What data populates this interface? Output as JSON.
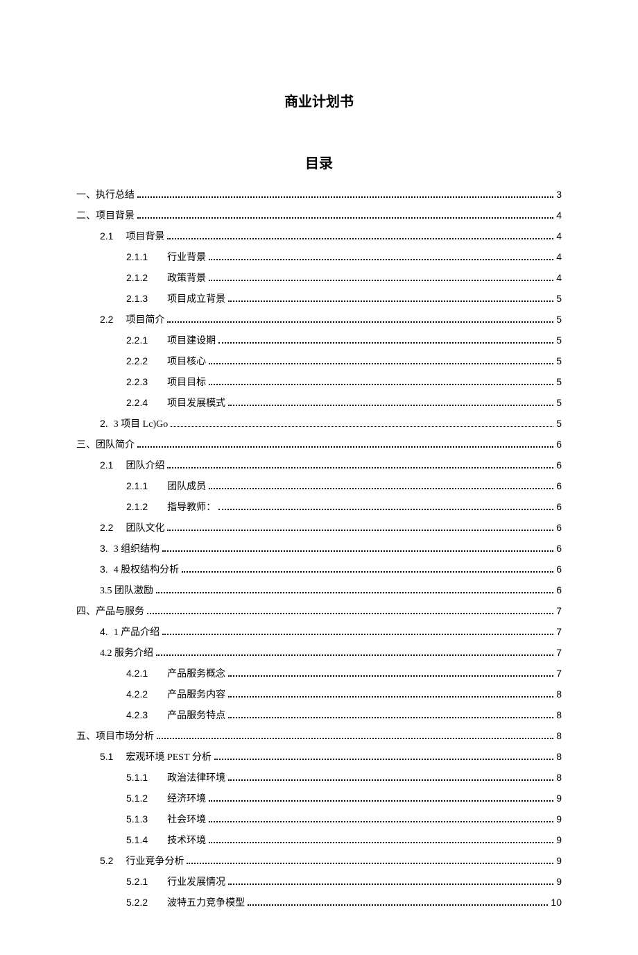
{
  "doc_title": "商业计划书",
  "toc_title": "目录",
  "toc": [
    {
      "indent": 0,
      "num": "",
      "text": "一、执行总结",
      "page": "3",
      "dot": "thick"
    },
    {
      "indent": 0,
      "num": "",
      "text": "二、项目背景",
      "page": "4",
      "dot": "thick"
    },
    {
      "indent": 1,
      "num": "2.1",
      "numClass": "num-l2",
      "text": "项目背景",
      "page": "4",
      "dot": "thick"
    },
    {
      "indent": 2,
      "num": "2.1.1",
      "numClass": "num-l3",
      "text": "行业背景",
      "page": "4",
      "dot": "thick"
    },
    {
      "indent": 2,
      "num": "2.1.2",
      "numClass": "num-l3",
      "text": "政策背景",
      "page": "4",
      "dot": "thick"
    },
    {
      "indent": 2,
      "num": "2.1.3",
      "numClass": "num-l3",
      "text": "项目成立背景",
      "page": "5",
      "dot": "thick"
    },
    {
      "indent": 1,
      "num": "2.2",
      "numClass": "num-l2",
      "text": "项目简介",
      "page": "5",
      "dot": "thick"
    },
    {
      "indent": 2,
      "num": "2.2.1",
      "numClass": "num-l3",
      "text": "项目建设期",
      "page": "5",
      "dot": "thick"
    },
    {
      "indent": 2,
      "num": "2.2.2",
      "numClass": "num-l3",
      "text": "项目核心",
      "page": "5",
      "dot": "thick"
    },
    {
      "indent": 2,
      "num": "2.2.3",
      "numClass": "num-l3",
      "text": "项目目标",
      "page": "5",
      "dot": "thick"
    },
    {
      "indent": 2,
      "num": "2.2.4",
      "numClass": "num-l3",
      "text": "项目发展模式",
      "page": "5",
      "dot": "thick"
    },
    {
      "indent": 1,
      "num": "2.",
      "numClass": "num-l2s",
      "text": "3 项目 Lc)Go",
      "page": "5",
      "dot": "thin"
    },
    {
      "indent": 0,
      "num": "",
      "text": "三、团队简介",
      "page": "6",
      "dot": "thick"
    },
    {
      "indent": 1,
      "num": "2.1",
      "numClass": "num-l2",
      "text": "团队介绍",
      "page": "6",
      "dot": "thick"
    },
    {
      "indent": 2,
      "num": "2.1.1",
      "numClass": "num-l3",
      "text": "团队成员",
      "page": "6",
      "dot": "thick"
    },
    {
      "indent": 2,
      "num": "2.1.2",
      "numClass": "num-l3",
      "text": "指导教师：",
      "page": "6",
      "dot": "thick"
    },
    {
      "indent": 1,
      "num": "2.2",
      "numClass": "num-l2",
      "text": "团队文化",
      "page": "6",
      "dot": "thick"
    },
    {
      "indent": 1,
      "num": "3.",
      "numClass": "num-l2s",
      "text": "3 组织结构",
      "page": "6",
      "dot": "thick"
    },
    {
      "indent": 1,
      "num": "3.",
      "numClass": "num-l2s",
      "text": "4 股权结构分析",
      "page": "6",
      "dot": "thick"
    },
    {
      "indent": 1,
      "num": "",
      "numClass": "",
      "text": "3.5 团队激励",
      "page": "6",
      "dot": "thick"
    },
    {
      "indent": 0,
      "num": "",
      "text": "四、产品与服务",
      "page": "7",
      "dot": "thick"
    },
    {
      "indent": 1,
      "num": "4.",
      "numClass": "num-l2s",
      "text": "1 产品介绍",
      "page": "7",
      "dot": "thick"
    },
    {
      "indent": 1,
      "num": "",
      "numClass": "",
      "text": "4.2 服务介绍",
      "page": "7",
      "dot": "thick"
    },
    {
      "indent": 2,
      "num": "4.2.1",
      "numClass": "num-l3",
      "text": "产品服务概念",
      "page": "7",
      "dot": "thick"
    },
    {
      "indent": 2,
      "num": "4.2.2",
      "numClass": "num-l3",
      "text": "产品服务内容",
      "page": "8",
      "dot": "thick"
    },
    {
      "indent": 2,
      "num": "4.2.3",
      "numClass": "num-l3",
      "text": "产品服务特点",
      "page": "8",
      "dot": "thick"
    },
    {
      "indent": 0,
      "num": "",
      "text": "五、项目市场分析",
      "page": "8",
      "dot": "thick"
    },
    {
      "indent": 1,
      "num": "5.1",
      "numClass": "num-l2",
      "text": "宏观环境 PEST 分析",
      "page": "8",
      "dot": "thick"
    },
    {
      "indent": 2,
      "num": "5.1.1",
      "numClass": "num-l3",
      "text": "政治法律环境",
      "page": "8",
      "dot": "thick"
    },
    {
      "indent": 2,
      "num": "5.1.2",
      "numClass": "num-l3",
      "text": "经济环境",
      "page": "9",
      "dot": "thick"
    },
    {
      "indent": 2,
      "num": "5.1.3",
      "numClass": "num-l3",
      "text": "社会环境",
      "page": "9",
      "dot": "thick"
    },
    {
      "indent": 2,
      "num": "5.1.4",
      "numClass": "num-l3",
      "text": "技术环境",
      "page": "9",
      "dot": "thick"
    },
    {
      "indent": 1,
      "num": "5.2",
      "numClass": "num-l2",
      "text": "行业竞争分析",
      "page": "9",
      "dot": "thick"
    },
    {
      "indent": 2,
      "num": "5.2.1",
      "numClass": "num-l3",
      "text": "行业发展情况",
      "page": "9",
      "dot": "thick"
    },
    {
      "indent": 2,
      "num": "5.2.2",
      "numClass": "num-l3",
      "text": "波特五力竞争模型",
      "page": "10",
      "dot": "thick"
    }
  ]
}
